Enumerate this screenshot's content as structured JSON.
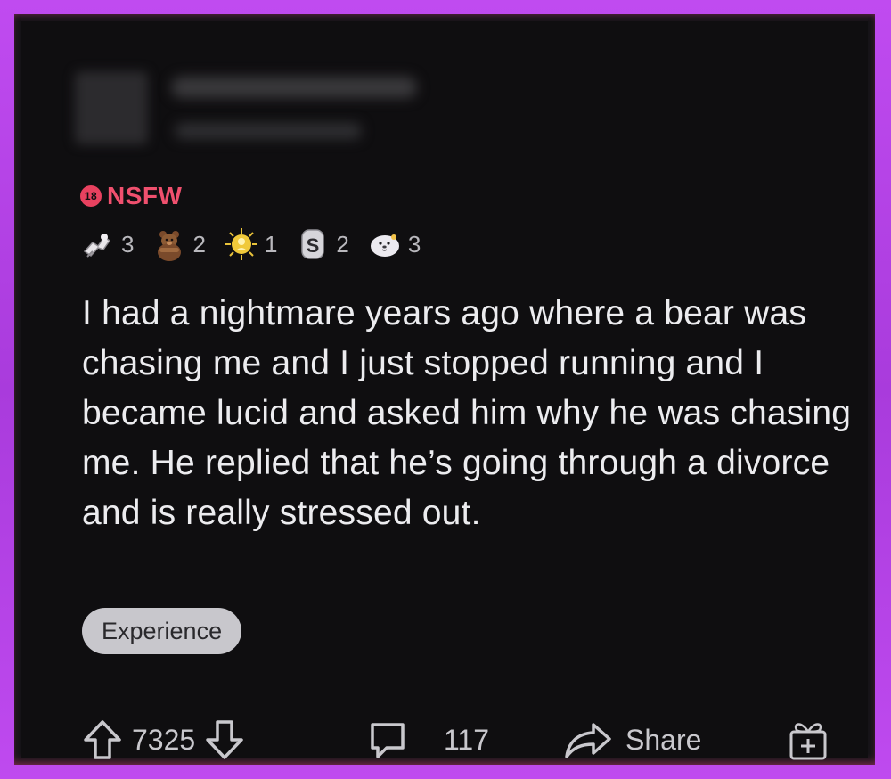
{
  "post": {
    "nsfw_badge": "18",
    "nsfw_label": "NSFW",
    "awards": [
      {
        "icon": "arm-wrestle-award-icon",
        "count": "3"
      },
      {
        "icon": "bear-hug-award-icon",
        "count": "2"
      },
      {
        "icon": "gold-award-icon",
        "count": "1"
      },
      {
        "icon": "silver-s-award-icon",
        "count": "2"
      },
      {
        "icon": "wholesome-seal-award-icon",
        "count": "3"
      }
    ],
    "body": "I had a nightmare years ago where a bear was chasing me and I just stopped running and I became lucid and asked him why he was chasing me. He replied that he’s going through a divorce and is really stressed out.",
    "flair": "Experience"
  },
  "actions": {
    "vote_count": "7325",
    "comment_count": "117",
    "share_label": "Share"
  },
  "colors": {
    "frame": "#b23ee0",
    "background": "#0f0e10",
    "nsfw": "#f0506e",
    "text": "#ececef",
    "muted": "#c9c8cd",
    "flair_bg": "#c8c7cc"
  }
}
